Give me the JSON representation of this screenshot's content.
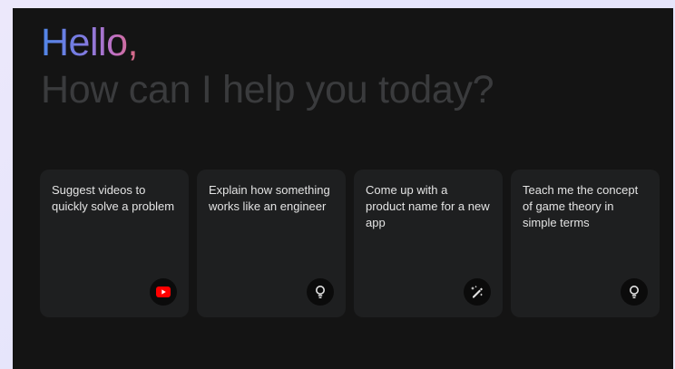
{
  "header": {
    "greeting": "Hello,",
    "prompt": "How can I help you today?"
  },
  "suggestions": [
    {
      "text": "Suggest videos to quickly solve a problem",
      "icon": "youtube-icon"
    },
    {
      "text": "Explain how something works like an engineer",
      "icon": "lightbulb-icon"
    },
    {
      "text": "Come up with a product name for a new app",
      "icon": "edit-sparkle-icon"
    },
    {
      "text": "Teach me the concept of game theory in simple terms",
      "icon": "lightbulb-icon"
    }
  ],
  "colors": {
    "page_background": "#ece8fb",
    "app_background": "#141414",
    "card_background": "#1e1f20",
    "card_text": "#e3e3e3",
    "prompt_text": "#3a3b3d",
    "greeting_gradient": [
      "#4f86e8",
      "#7f7ae0",
      "#c071c4",
      "#d9697e"
    ],
    "youtube_red": "#ff0000"
  }
}
